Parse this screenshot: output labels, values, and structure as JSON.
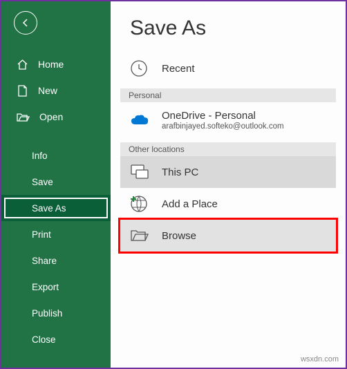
{
  "sidebar": {
    "primary": [
      {
        "label": "Home"
      },
      {
        "label": "New"
      },
      {
        "label": "Open"
      }
    ],
    "secondary": [
      {
        "label": "Info"
      },
      {
        "label": "Save"
      },
      {
        "label": "Save As"
      },
      {
        "label": "Print"
      },
      {
        "label": "Share"
      },
      {
        "label": "Export"
      },
      {
        "label": "Publish"
      },
      {
        "label": "Close"
      }
    ]
  },
  "main": {
    "title": "Save As",
    "recent": "Recent",
    "section_personal": "Personal",
    "onedrive_title": "OneDrive - Personal",
    "onedrive_sub": "arafbinjayed.softeko@outlook.com",
    "section_other": "Other locations",
    "this_pc": "This PC",
    "add_place": "Add a Place",
    "browse": "Browse"
  },
  "watermark": "wsxdn.com"
}
